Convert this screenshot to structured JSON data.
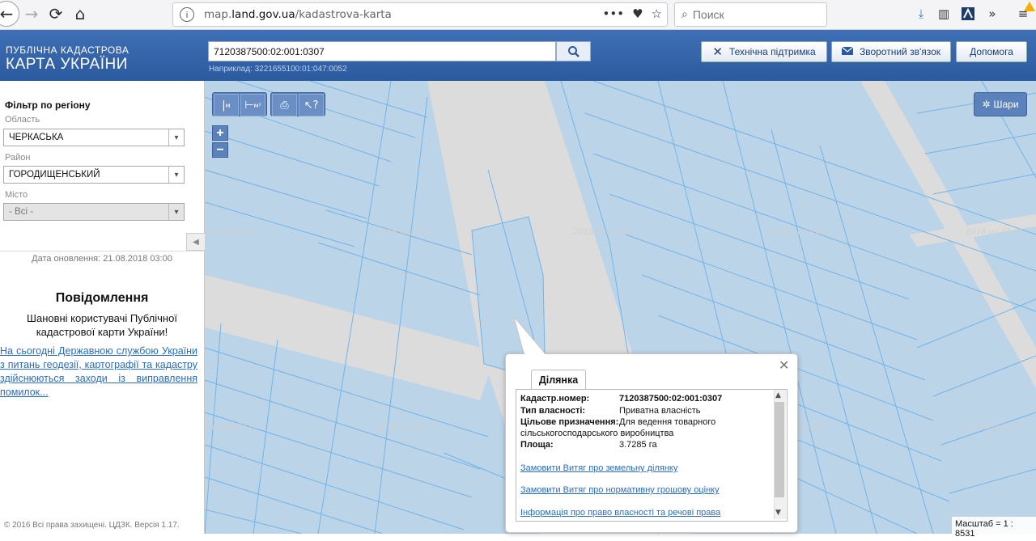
{
  "browser": {
    "url_prefix": "map.",
    "url_domain": "land.gov.ua",
    "url_path": "/kadastrova-karta",
    "search_placeholder": "Поиск",
    "page_actions": "•••"
  },
  "header": {
    "logo_line1": "ПУБЛІЧНА КАДАСТРОВА",
    "logo_line2": "КАРТА УКРАЇНИ",
    "search_value": "7120387500:02:001:0307",
    "search_example": "Наприклад: 3221655100:01:047:0052",
    "buttons": {
      "support": "Технічна підтримка",
      "feedback": "Зворотний зв'язок",
      "help": "Допомога"
    }
  },
  "sidebar": {
    "filter_title": "Фільтр по регіону",
    "oblast_label": "Область",
    "oblast_value": "ЧЕРКАСЬКА",
    "raion_label": "Район",
    "raion_value": "ГОРОДИЩЕНСЬКИЙ",
    "misto_label": "Місто",
    "misto_value": "- Всі -",
    "update_date": "Дата оновлення: 21.08.2018 03:00",
    "message_title": "Повідомлення",
    "message_text": "Шановні користувачі Публічної кадастрової карти України!",
    "message_link": "На сьогодні Державною службою України з питань геодезії, картографії та кадастру здійснюються заходи із виправлення помилок...",
    "copyright": "© 2016 Всі права захищені. ЦДЗК. Версія 1.17."
  },
  "map": {
    "layers_label": "Шари",
    "scale": "Масштаб = 1 : 8531",
    "watermark": "2018.ua.SLCC",
    "zoom_in": "+",
    "zoom_out": "−"
  },
  "popup": {
    "tab": "Ділянка",
    "rows": [
      {
        "label": "Кадастр.номер:",
        "value": "7120387500:02:001:0307"
      },
      {
        "label": "Тип власності:",
        "value": "Приватна власність"
      },
      {
        "label": "Цільове призначення:",
        "value": "Для ведення товарного"
      },
      {
        "label": "сільськогосподарського виробництва",
        "value": ""
      },
      {
        "label": "Площа:",
        "value": "3.7285 га"
      }
    ],
    "links": [
      "Замовити Витяг про земельну ділянку",
      "Замовити Витяг про нормативну грошову оцінку",
      "Інформація про право власності та речові права"
    ]
  },
  "colors": {
    "header_bg": "#3a69b0",
    "map_bg": "#bcd4e8",
    "map_road": "#dcdcdc",
    "parcel_line": "#6fb4ea",
    "link": "#2a6dbf"
  }
}
